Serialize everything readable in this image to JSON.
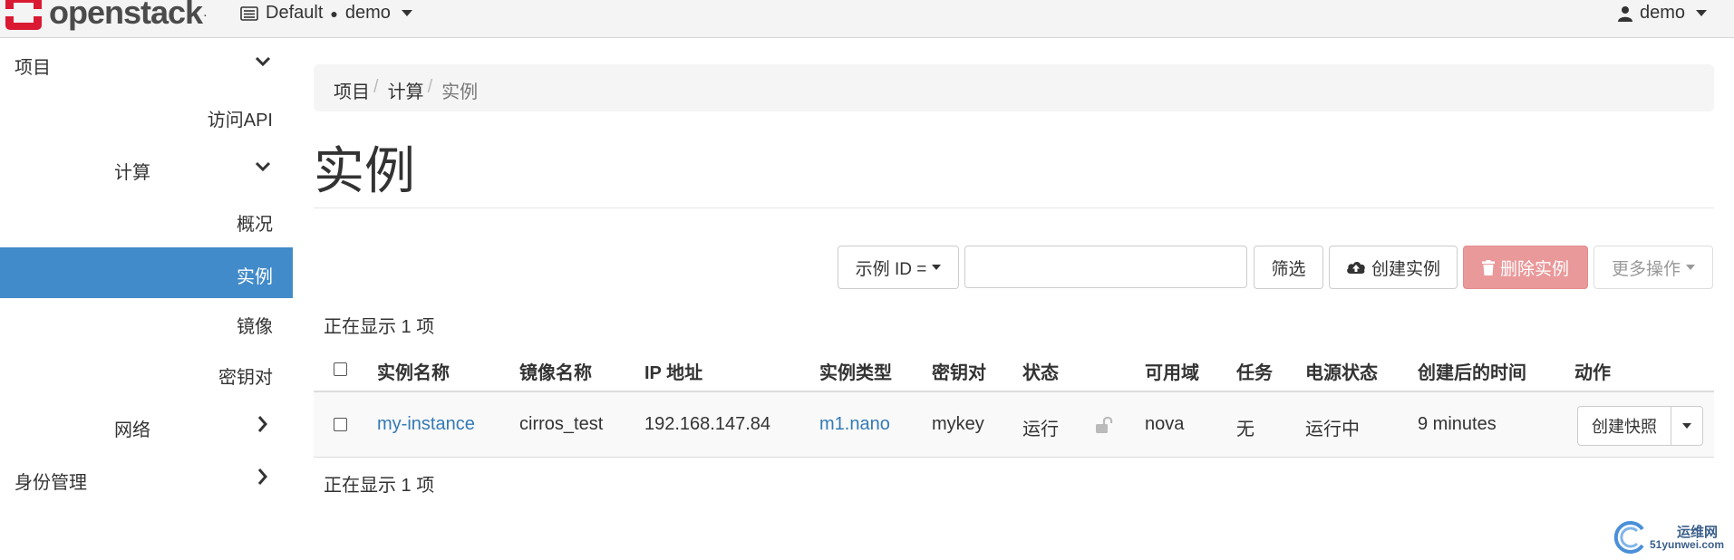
{
  "navbar": {
    "brand": "openstack",
    "brand_mark_color": "#da1a32",
    "domain": "Default",
    "project": "demo",
    "user": "demo"
  },
  "sidebar": {
    "items": [
      {
        "label": "项目",
        "chevron": "down"
      },
      {
        "label": "访问API"
      },
      {
        "label": "计算",
        "chevron": "down"
      },
      {
        "label": "概况"
      },
      {
        "label": "实例",
        "active": true
      },
      {
        "label": "镜像"
      },
      {
        "label": "密钥对"
      },
      {
        "label": "网络",
        "chevron": "right"
      },
      {
        "label": "身份管理",
        "chevron": "right"
      }
    ],
    "active_color": "#428bca"
  },
  "breadcrumb": {
    "items": [
      "项目",
      "计算",
      "实例"
    ]
  },
  "page_title": "实例",
  "toolbar": {
    "filter_select": "示例 ID =",
    "filter_value": "",
    "filter_button": "筛选",
    "create_button": "创建实例",
    "delete_button": "删除实例",
    "more_button": "更多操作"
  },
  "table": {
    "count_text": "正在显示 1 项",
    "columns": [
      "实例名称",
      "镜像名称",
      "IP 地址",
      "实例类型",
      "密钥对",
      "状态",
      "可用域",
      "任务",
      "电源状态",
      "创建后的时间",
      "动作"
    ],
    "rows": [
      {
        "name": "my-instance",
        "image": "cirros_test",
        "ip": "192.168.147.84",
        "flavor": "m1.nano",
        "keypair": "mykey",
        "status": "运行",
        "zone": "nova",
        "task": "无",
        "power": "运行中",
        "age": "9 minutes",
        "action": "创建快照"
      }
    ]
  },
  "watermark": {
    "line1": "运维网",
    "line2": "51yunwei.com"
  }
}
